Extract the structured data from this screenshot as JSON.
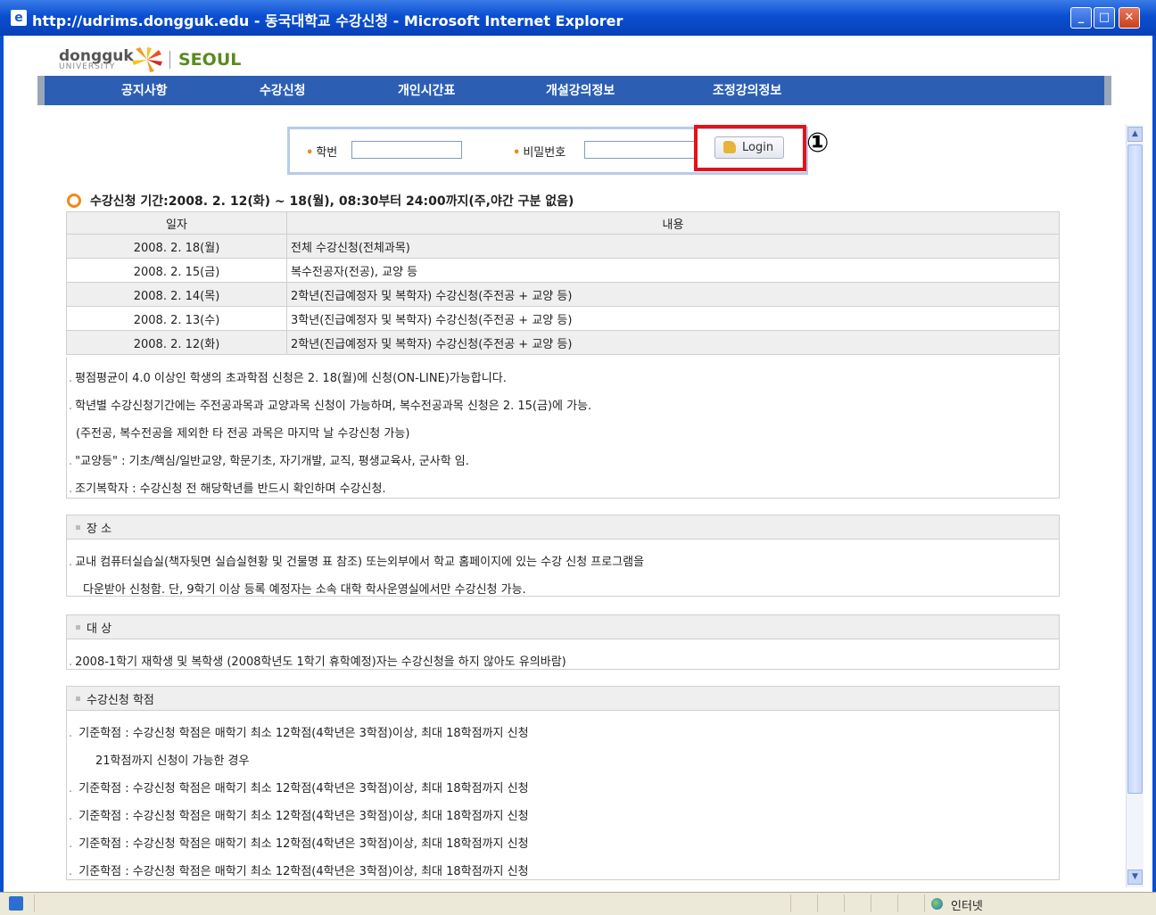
{
  "window": {
    "title": "http://udrims.dongguk.edu - 동국대학교 수강신청 - Microsoft Internet Explorer"
  },
  "logo": {
    "name": "dongguk",
    "sub": "UNIVERSITY",
    "campus": "SEOUL"
  },
  "nav": {
    "items": [
      "공지사항",
      "수강신청",
      "개인시간표",
      "개설강의정보",
      "조정강의정보"
    ]
  },
  "login": {
    "id_label": "학번",
    "pw_label": "비밀번호",
    "button": "Login",
    "annotation": "①"
  },
  "period": {
    "text": "수강신청 기간:2008. 2. 12(화) ~ 18(월), 08:30부터 24:00까지(주,야간 구분 없음)"
  },
  "schedule": {
    "headers": [
      "일자",
      "내용"
    ],
    "rows": [
      [
        "2008. 2. 18(월)",
        "전체 수강신청(전체과목)"
      ],
      [
        "2008. 2. 15(금)",
        "복수전공자(전공), 교양 등"
      ],
      [
        "2008. 2. 14(목)",
        "2학년(진급예정자 및 복학자) 수강신청(주전공 + 교양 등)"
      ],
      [
        "2008. 2. 13(수)",
        "3학년(진급예정자 및 복학자) 수강신청(주전공 + 교양 등)"
      ],
      [
        "2008. 2. 12(화)",
        "2학년(진급예정자 및 복학자) 수강신청(주전공 + 교양 등)"
      ]
    ]
  },
  "notes": [
    "평점평균이 4.0 이상인 학생의 초과학점 신청은 2. 18(월)에 신청(ON-LINE)가능합니다.",
    "학년별 수강신청기간에는 주전공과목과 교양과목 신청이 가능하며, 복수전공과목 신청은 2. 15(금)에 가능.",
    "(주전공, 복수전공을 제외한 타 전공 과목은 마지막 날 수강신청 가능)",
    "\"교양등\" : 기초/핵심/일반교양, 학문기초, 자기개발, 교직, 평생교육사, 군사학 임.",
    "조기복학자 : 수강신청 전 해당학년를 반드시 확인하며 수강신청."
  ],
  "place": {
    "title": "장 소",
    "lines": [
      "교내 컴퓨터실습실(책자뒷면 실습실현황 및 건물명 표 참조) 또는외부에서 학교 홈페이지에 있는 수강 신청 프로그램을",
      "다운받아 신청함. 단, 9학기 이상 등록 예정자는 소속 대학 학사운영실에서만 수강신청 가능."
    ]
  },
  "target": {
    "title": "대 상",
    "lines": [
      "2008-1학기 재학생 및 복학생 (2008학년도 1학기 휴학예정)자는 수강신청을 하지 않아도 유의바람)"
    ]
  },
  "credits": {
    "title": "수강신청 학점",
    "lines": [
      "기준학점 : 수강신청 학점은 매학기 최소 12학점(4학년은 3학점)이상, 최대 18학점까지 신청",
      "21학점까지 신청이 가능한 경우",
      "기준학점 : 수강신청 학점은 매학기 최소 12학점(4학년은 3학점)이상, 최대 18학점까지 신청",
      "기준학점 : 수강신청 학점은 매학기 최소 12학점(4학년은 3학점)이상, 최대 18학점까지 신청",
      "기준학점 : 수강신청 학점은 매학기 최소 12학점(4학년은 3학점)이상, 최대 18학점까지 신청",
      "기준학점 : 수강신청 학점은 매학기 최소 12학점(4학년은 3학점)이상, 최대 18학점까지 신청"
    ]
  },
  "status": {
    "zone": "인터넷"
  },
  "colors": {
    "nav": "#2c5fb4",
    "accent": "#f08a1c",
    "highlight": "#e3121b"
  }
}
